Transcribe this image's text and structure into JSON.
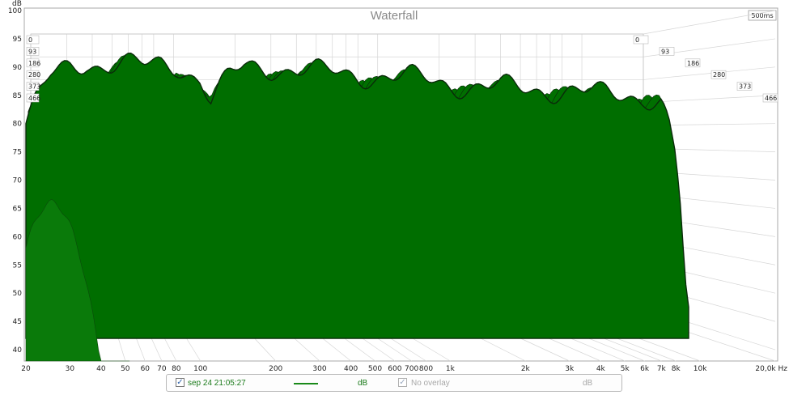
{
  "chart_data": {
    "type": "waterfall",
    "title": "Waterfall",
    "time_window_label": "500ms",
    "y_unit": "dB",
    "x_unit": "Hz",
    "ylim": [
      38,
      100
    ],
    "y_ticks": [
      {
        "v": 100,
        "label": "100"
      },
      {
        "v": 95,
        "label": "95"
      },
      {
        "v": 90,
        "label": "90"
      },
      {
        "v": 85,
        "label": "85"
      },
      {
        "v": 80,
        "label": "80"
      },
      {
        "v": 75,
        "label": "75"
      },
      {
        "v": 70,
        "label": "70"
      },
      {
        "v": 65,
        "label": "65"
      },
      {
        "v": 60,
        "label": "60"
      },
      {
        "v": 55,
        "label": "55"
      },
      {
        "v": 50,
        "label": "50"
      },
      {
        "v": 45,
        "label": "45"
      },
      {
        "v": 40,
        "label": "40"
      }
    ],
    "xlim": [
      20,
      20000
    ],
    "x_scale": "log",
    "x_ticks": [
      {
        "v": 20,
        "label": "20"
      },
      {
        "v": 30,
        "label": "30"
      },
      {
        "v": 40,
        "label": "40"
      },
      {
        "v": 50,
        "label": "50"
      },
      {
        "v": 60,
        "label": "60"
      },
      {
        "v": 70,
        "label": "70"
      },
      {
        "v": 80,
        "label": "80"
      },
      {
        "v": 100,
        "label": "100"
      },
      {
        "v": 200,
        "label": "200"
      },
      {
        "v": 300,
        "label": "300"
      },
      {
        "v": 400,
        "label": "400"
      },
      {
        "v": 500,
        "label": "500"
      },
      {
        "v": 600,
        "label": "600"
      },
      {
        "v": 700,
        "label": "700"
      },
      {
        "v": 800,
        "label": "800"
      },
      {
        "v": 1000,
        "label": "1k"
      },
      {
        "v": 2000,
        "label": "2k"
      },
      {
        "v": 3000,
        "label": "3k"
      },
      {
        "v": 4000,
        "label": "4k"
      },
      {
        "v": 5000,
        "label": "5k"
      },
      {
        "v": 6000,
        "label": "6k"
      },
      {
        "v": 7000,
        "label": "7k"
      },
      {
        "v": 8000,
        "label": "8k"
      },
      {
        "v": 10000,
        "label": "10k"
      },
      {
        "v": 20000,
        "label": "20,0k Hz"
      }
    ],
    "time_slices_ms": [
      "0",
      "93",
      "186",
      "280",
      "373",
      "466"
    ],
    "series": [
      {
        "name": "sep 24 21:05:27",
        "color": "#1a8a1a",
        "envelope_db": [
          [
            20,
            80
          ],
          [
            22,
            84
          ],
          [
            25,
            88
          ],
          [
            30,
            90
          ],
          [
            35,
            91
          ],
          [
            40,
            90.5
          ],
          [
            50,
            90.5
          ],
          [
            60,
            90
          ],
          [
            70,
            90.5
          ],
          [
            80,
            90.5
          ],
          [
            100,
            88
          ],
          [
            110,
            84
          ],
          [
            130,
            88
          ],
          [
            150,
            90
          ],
          [
            200,
            90
          ],
          [
            300,
            89
          ],
          [
            500,
            88.5
          ],
          [
            700,
            88
          ],
          [
            1000,
            87
          ],
          [
            2000,
            86
          ],
          [
            3000,
            86
          ],
          [
            4000,
            85
          ],
          [
            5000,
            85
          ],
          [
            6000,
            85
          ],
          [
            7000,
            84
          ],
          [
            7500,
            80
          ],
          [
            8000,
            74
          ],
          [
            8400,
            64
          ],
          [
            8700,
            52
          ],
          [
            9000,
            46
          ]
        ]
      }
    ]
  },
  "legend": {
    "series_label": "sep 24 21:05:27",
    "series_checked": true,
    "series_unit": "dB",
    "overlay_label": "No overlay",
    "overlay_checked": true,
    "overlay_unit": "dB"
  }
}
